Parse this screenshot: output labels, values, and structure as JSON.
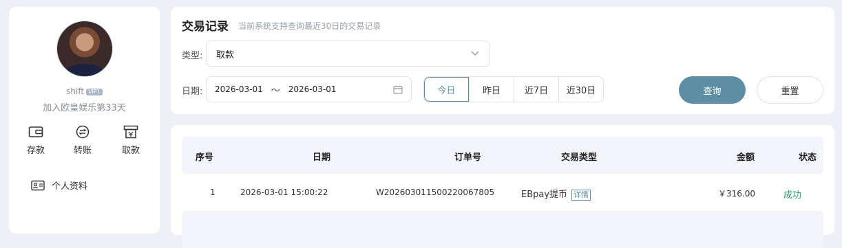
{
  "profile": {
    "username": "shift",
    "vip_badge": "VIP1",
    "joined_text": "加入欧皇娱乐第33天"
  },
  "quick_actions": [
    {
      "label": "存款",
      "icon": "wallet-icon"
    },
    {
      "label": "转账",
      "icon": "transfer-icon"
    },
    {
      "label": "取款",
      "icon": "withdraw-icon"
    }
  ],
  "menu": [
    {
      "label": "个人资料",
      "icon": "id-card-icon"
    }
  ],
  "header": {
    "title": "交易记录",
    "subtitle": "当前系统支持查询最近30日的交易记录"
  },
  "filters": {
    "type_label": "类型:",
    "type_value": "取款",
    "date_label": "日期:",
    "date_start": "2026-03-01",
    "date_sep": "～",
    "date_end": "2026-03-01",
    "ranges": [
      "今日",
      "昨日",
      "近7日",
      "近30日"
    ],
    "active_range": "今日",
    "query_label": "查询",
    "reset_label": "重置"
  },
  "table": {
    "columns": [
      "序号",
      "日期",
      "订单号",
      "交易类型",
      "金额",
      "状态"
    ],
    "rows": [
      {
        "index": "1",
        "date": "2026-03-01 15:00:22",
        "order": "W202603011500220067805",
        "type": "EBpay提币",
        "detail": "详情",
        "amount": "￥316.00",
        "status": "成功"
      }
    ]
  },
  "colors": {
    "accent": "#5e8ea4",
    "success": "#28a06a",
    "background": "#eef0f5"
  }
}
